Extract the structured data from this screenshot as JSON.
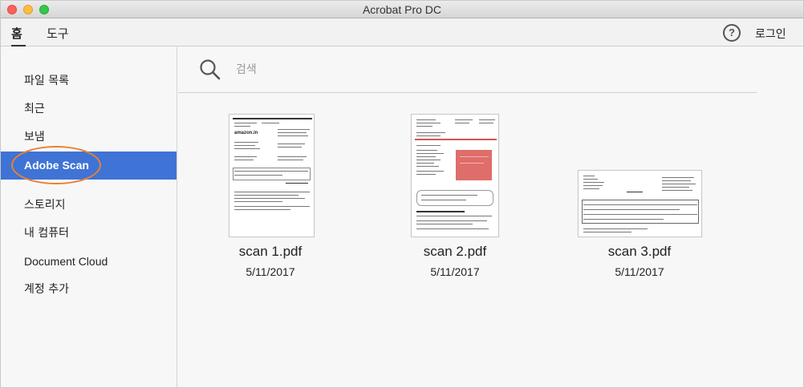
{
  "window": {
    "title": "Acrobat Pro DC"
  },
  "toolbar": {
    "tabs": [
      {
        "label": "홈"
      },
      {
        "label": "도구"
      }
    ],
    "help_label": "?",
    "login_label": "로그인"
  },
  "sidebar": {
    "items": [
      {
        "label": "파일 목록"
      },
      {
        "label": "최근"
      },
      {
        "label": "보냄"
      },
      {
        "label": "Adobe Scan",
        "active": true
      },
      {
        "label": "스토리지"
      },
      {
        "label": "내 컴퓨터"
      },
      {
        "label": "Document Cloud"
      },
      {
        "label": "계정 추가"
      }
    ]
  },
  "search": {
    "placeholder": "검색",
    "value": ""
  },
  "files": [
    {
      "name": "scan 1.pdf",
      "date": "5/11/2017",
      "logo_text": "amazon.in"
    },
    {
      "name": "scan 2.pdf",
      "date": "5/11/2017"
    },
    {
      "name": "scan 3.pdf",
      "date": "5/11/2017"
    }
  ],
  "colors": {
    "active_item": "#3f73d6",
    "highlight_ring": "#e8822e",
    "stamp_red": "#d9534f"
  }
}
